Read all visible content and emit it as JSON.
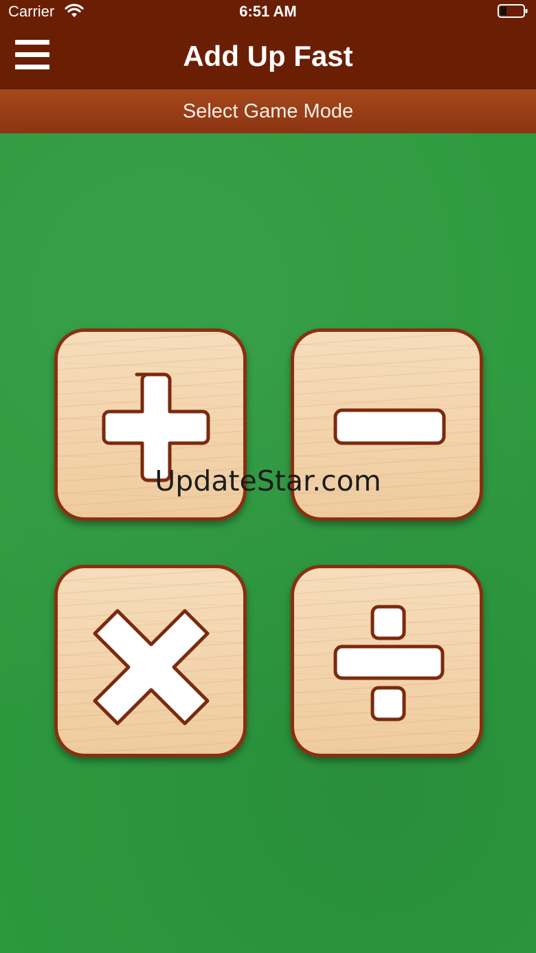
{
  "status_bar": {
    "carrier": "Carrier",
    "time": "6:51 AM"
  },
  "nav_bar": {
    "title": "Add Up Fast",
    "menu_icon": "hamburger-menu-icon"
  },
  "sub_header": {
    "title": "Select Game Mode"
  },
  "game_modes": [
    {
      "icon": "plus-icon"
    },
    {
      "icon": "minus-icon"
    },
    {
      "icon": "multiply-icon"
    },
    {
      "icon": "divide-icon"
    }
  ],
  "watermark": "UpdateStar.com",
  "colors": {
    "nav_bar": "#6a1f04",
    "sub_bar": "#9a3f18",
    "felt_green": "#2d9a3f",
    "tile_wood": "#f5d8b3",
    "tile_border": "#8a2f0f"
  }
}
